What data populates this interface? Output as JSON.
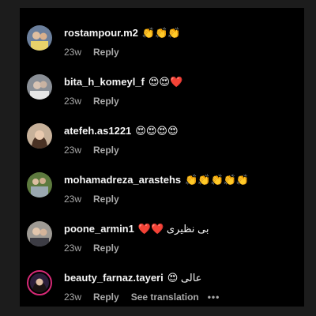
{
  "comments": [
    {
      "username": "rostampour.m2",
      "text": "👏👏👏",
      "time": "23w",
      "reply_label": "Reply"
    },
    {
      "username": "bita_h_komeyl_f",
      "text": "😍😍❤️",
      "time": "23w",
      "reply_label": "Reply"
    },
    {
      "username": "atefeh.as1221",
      "text": "😍😍😍😍",
      "time": "23w",
      "reply_label": "Reply"
    },
    {
      "username": "mohamadreza_arastehs",
      "text": "👏👏👏👏👏",
      "time": "23w",
      "reply_label": "Reply"
    },
    {
      "username": "poone_armin1",
      "text": "❤️❤️ بی نظیری",
      "time": "23w",
      "reply_label": "Reply"
    },
    {
      "username": "beauty_farnaz.tayeri",
      "text": "😍 عالی",
      "time": "23w",
      "reply_label": "Reply",
      "translation_label": "See translation",
      "more_label": "•••"
    }
  ],
  "colors": {
    "background": "#000000",
    "text": "#f5f5f5",
    "secondary": "#a8a8a8",
    "story_ring": "#d62976"
  }
}
